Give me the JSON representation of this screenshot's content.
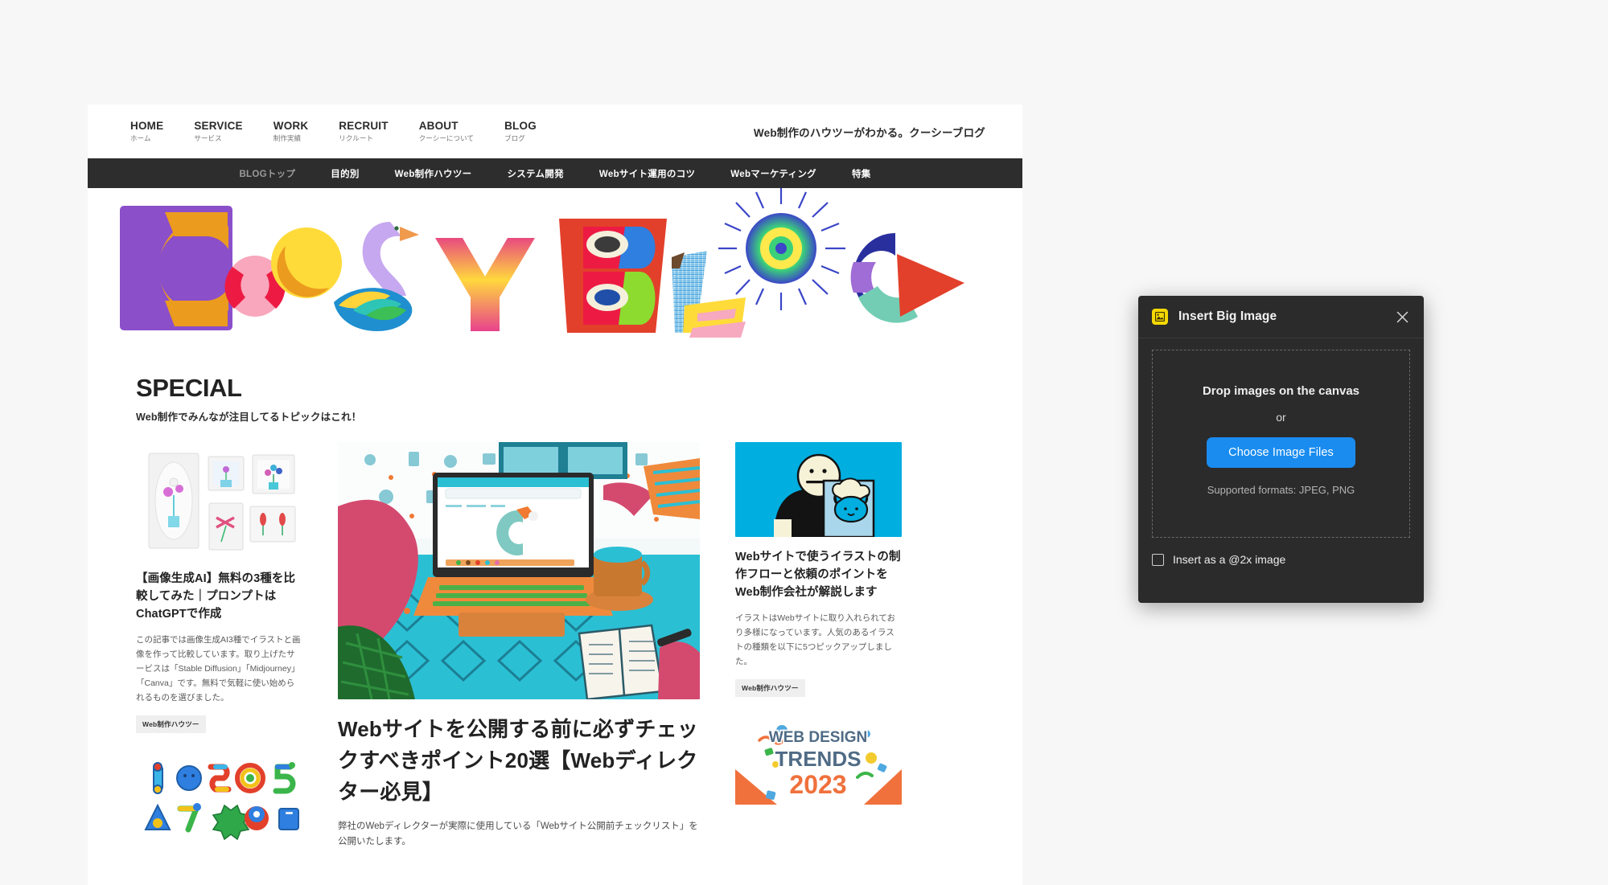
{
  "site": {
    "global_nav": [
      {
        "en": "HOME",
        "jp": "ホーム"
      },
      {
        "en": "SERVICE",
        "jp": "サービス"
      },
      {
        "en": "WORK",
        "jp": "制作実績"
      },
      {
        "en": "RECRUIT",
        "jp": "リクルート"
      },
      {
        "en": "ABOUT",
        "jp": "クーシーについて"
      },
      {
        "en": "BLOG",
        "jp": "ブログ"
      }
    ],
    "tagline": "Web制作のハウツーがわかる。クーシーブログ",
    "subnav": [
      {
        "label": "BLOGトップ",
        "active": true
      },
      {
        "label": "目的別",
        "active": false
      },
      {
        "label": "Web制作ハウツー",
        "active": false
      },
      {
        "label": "システム開発",
        "active": false
      },
      {
        "label": "Webサイト運用のコツ",
        "active": false
      },
      {
        "label": "Webマーケティング",
        "active": false
      },
      {
        "label": "特集",
        "active": false
      }
    ],
    "hero": {
      "alt": "COOSY BLOG illustrated lettering"
    },
    "special": {
      "heading": "SPECIAL",
      "subheading": "Web制作でみんなが注目してるトピックはこれ！"
    },
    "cards": {
      "left_top": {
        "image_alt": "white picture frames with flowers",
        "title": "【画像生成AI】無料の3種を比較してみた｜プロンプトはChatGPTで作成",
        "desc": "この記事では画像生成AI3種でイラストと画像を作って比較しています。取り上げたサービスは「Stable Diffusion」「Midjourney」「Canva」です。無料で気軽に使い始められるものを選びました。",
        "tag": "Web制作ハウツー"
      },
      "left_bottom": {
        "image_alt": "colorful 3D numbers and icons"
      },
      "center": {
        "image_alt": "illustration of person at laptop with COOSY logo",
        "title": "Webサイトを公開する前に必ずチェックすべきポイント20選【Webディレクター必見】",
        "desc": "弊社のWebディレクターが実際に使用している「Webサイト公開前チェックリスト」を公開いたします。"
      },
      "right_top": {
        "image_alt": "person holding a cat drawing on blue background",
        "title": "Webサイトで使うイラストの制作フローと依頼のポイントをWeb制作会社が解説します",
        "desc": "イラストはWebサイトに取り入れられており多様になっています。人気のあるイラストの種類を以下に5つピックアップしました。",
        "tag": "Web制作ハウツー"
      },
      "right_bottom": {
        "image_alt": "WEB DESIGN TRENDS 2023 banner",
        "banner_line1": "WEB DESIGN",
        "banner_line2": "TRENDS",
        "banner_line3": "2023"
      }
    }
  },
  "dialog": {
    "title": "Insert Big Image",
    "icon": "image-icon",
    "close_icon": "close-icon",
    "drop_title": "Drop images on the canvas",
    "or_label": "or",
    "choose_button": "Choose Image Files",
    "supported_formats": "Supported formats: JPEG, PNG",
    "checkbox_label": "Insert as a @2x image",
    "checkbox_checked": false
  },
  "colors": {
    "accent_blue": "#1a8cf0",
    "dialog_bg": "#2b2b2b",
    "subnav_bg": "#2d2d2d",
    "icon_yellow": "#f5d800",
    "page_bg": "#f7f7f7"
  }
}
